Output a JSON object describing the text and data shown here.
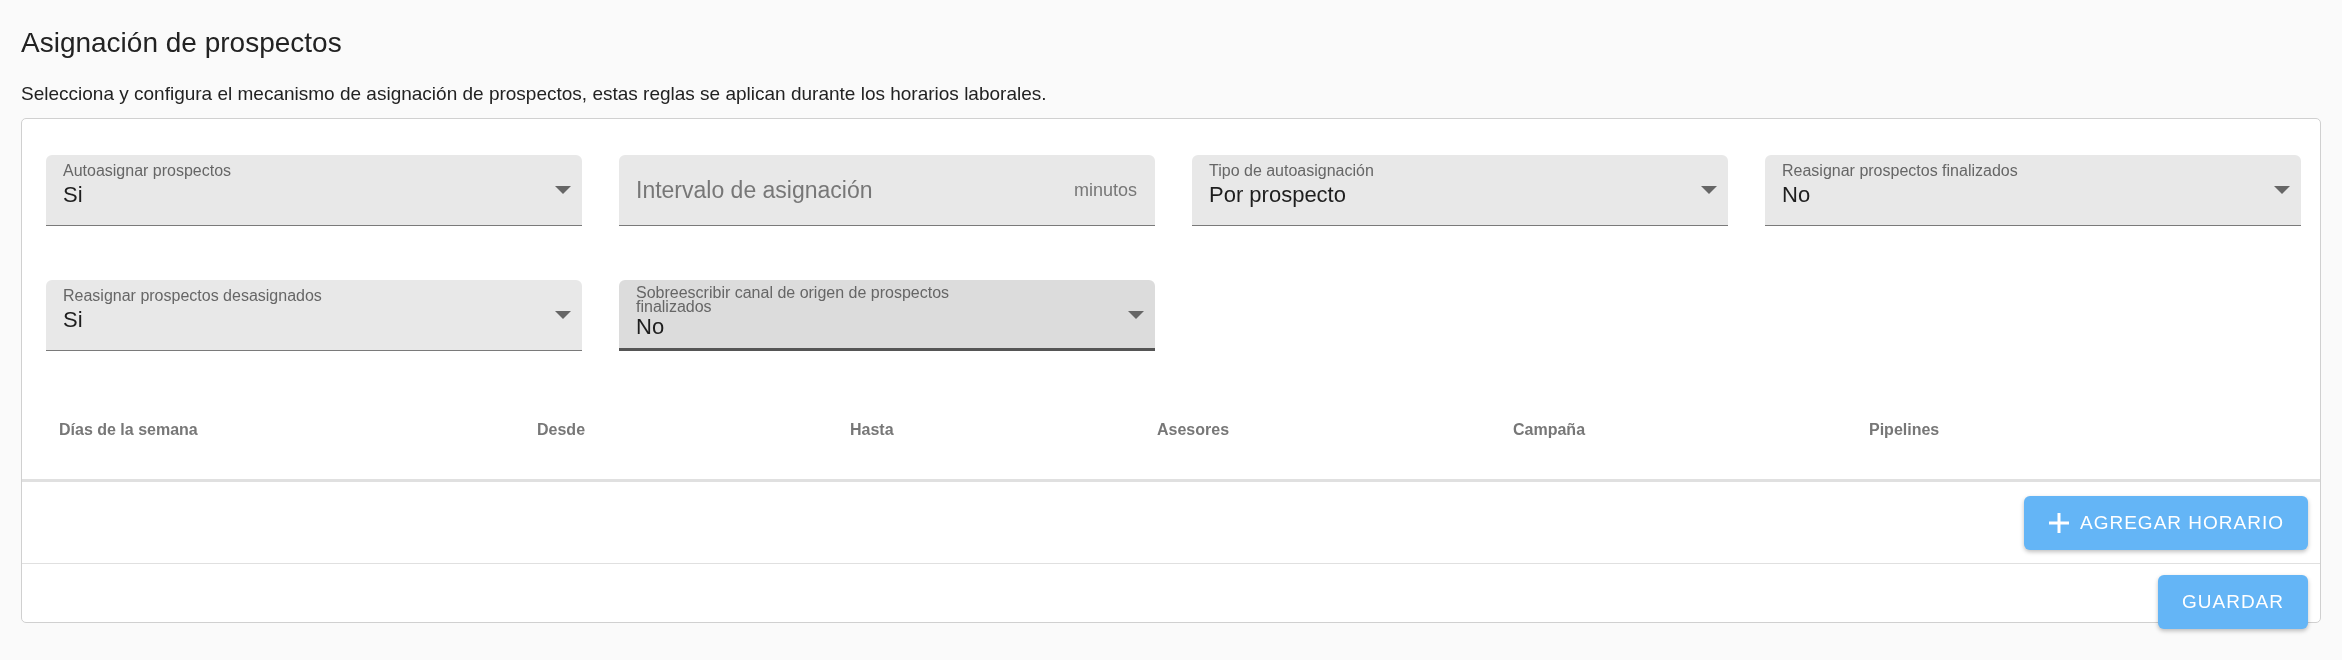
{
  "title": "Asignación de prospectos",
  "description": "Selecciona y configura el mecanismo de asignación de prospectos, estas reglas se aplican durante los horarios laborales.",
  "fields": [
    {
      "kind": "select",
      "label": "Autoasignar prospectos",
      "value": "Si",
      "focused": false
    },
    {
      "kind": "text",
      "placeholder": "Intervalo de asignación",
      "suffix": "minutos",
      "focused": false
    },
    {
      "kind": "select",
      "label": "Tipo de autoasignación",
      "value": "Por prospecto",
      "focused": false
    },
    {
      "kind": "select",
      "label": "Reasignar prospectos finalizados",
      "value": "No",
      "focused": false
    },
    {
      "kind": "select",
      "label": "Reasignar prospectos desasignados",
      "value": "Si",
      "focused": false
    },
    {
      "kind": "select",
      "label": "Sobreescribir canal de origen de prospectos finalizados",
      "value": "No",
      "focused": true
    }
  ],
  "table": {
    "columns": [
      "Días de la semana",
      "Desde",
      "Hasta",
      "Asesores",
      "Campaña",
      "Pipelines"
    ]
  },
  "buttons": [
    {
      "kind": "add",
      "label": "AGREGAR HORARIO"
    },
    {
      "kind": "plain",
      "label": "GUARDAR"
    }
  ]
}
